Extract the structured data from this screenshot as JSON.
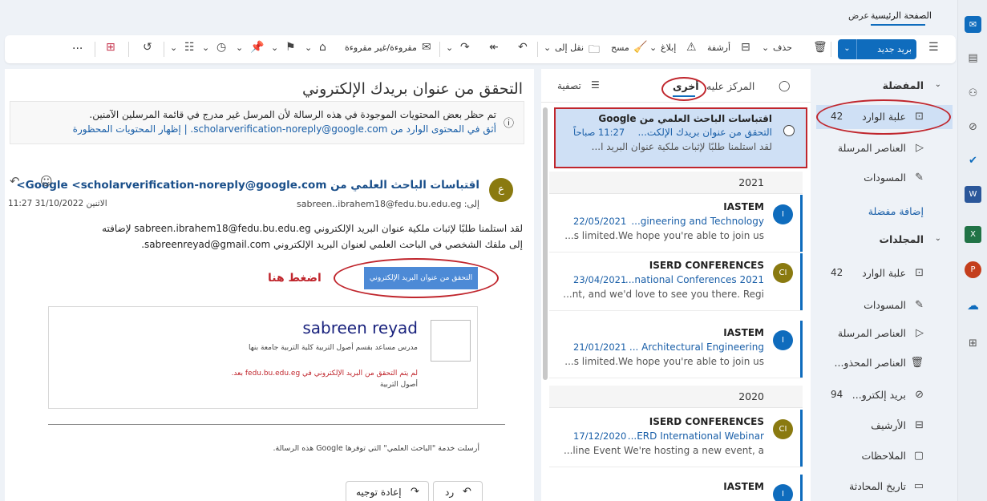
{
  "tabs": {
    "home": "الصفحة الرئيسية",
    "view": "عرض"
  },
  "ribbon": {
    "new_mail": "بريد جديد",
    "delete": "حذف",
    "archive": "أرشفة",
    "report": "إبلاغ",
    "sweep": "مسح",
    "move_to": "نقل إلى",
    "read_unread": "مقروءة/غير مقروءة",
    "more": "..."
  },
  "folders": {
    "favorites_header": "المفضلة",
    "favorites": [
      {
        "label": "علبة الوارد",
        "count": "42"
      },
      {
        "label": "العناصر المرسلة",
        "count": ""
      },
      {
        "label": "المسودات",
        "count": ""
      }
    ],
    "add_favorite": "إضافة مفضلة",
    "folders_header": "المجلدات",
    "items": [
      {
        "label": "علبة الوارد",
        "count": "42"
      },
      {
        "label": "المسودات",
        "count": ""
      },
      {
        "label": "العناصر المرسلة",
        "count": ""
      },
      {
        "label": "العناصر المحذو...",
        "count": ""
      },
      {
        "label": "بريد إلكترو...",
        "count": "94"
      },
      {
        "label": "الأرشيف",
        "count": ""
      },
      {
        "label": "الملاحظات",
        "count": ""
      },
      {
        "label": "تاريخ المحادثة",
        "count": ""
      }
    ]
  },
  "list": {
    "focused_tab": "المركز عليه",
    "other_tab": "أخرى",
    "filter": "تصفية",
    "selected": {
      "sender": "اقتباسات الباحث العلمي من Google",
      "subject": "التحقق من عنوان بريدك الإلكت...",
      "time": "11:27 صباحاً",
      "preview": "لقد استلمنا طلبًا لإثبات ملكية عنوان البريد ا..."
    },
    "year_2021": "2021",
    "year_2020": "2020",
    "messages": [
      {
        "sender": "IASTEM",
        "initial": "I",
        "date": "22/05/2021",
        "subject": "...gineering and Technology",
        "preview": "...s limited.We hope you're able to join us",
        "color": "#0f6cbd"
      },
      {
        "sender": "ISERD CONFERENCES",
        "initial": "CI",
        "date": "23/04/2021",
        "subject": "...national Conferences 2021",
        "preview": "...nt, and we'd love to see you there. Regi",
        "color": "#8a7a10"
      },
      {
        "sender": "IASTEM",
        "initial": "I",
        "date": "21/01/2021",
        "subject": "... Architectural Engineering",
        "preview": "...s limited.We hope you're able to join us",
        "color": "#0f6cbd"
      },
      {
        "sender": "ISERD CONFERENCES",
        "initial": "CI",
        "date": "17/12/2020",
        "subject": "...ERD International Webinar",
        "preview": "...line Event We're hosting a new event, a",
        "color": "#8a7a10"
      },
      {
        "sender": "IASTEM",
        "initial": "I",
        "date": "",
        "subject": "",
        "preview": "",
        "color": "#0f6cbd"
      }
    ]
  },
  "reading": {
    "title": "التحقق من عنوان بريدك الإلكتروني",
    "warning_line1": "تم حظر بعض المحتويات الموجودة في هذه الرسالة لأن المرسل غير مدرج في قائمة المرسلين الآمنين.",
    "warning_line2": "أثق في المحتوى الوارد من scholarverification-noreply@google.com. | إظهار المحتويات المحظورة",
    "sender": "اقتباسات الباحث العلمي من Google <scholarverification-noreply@google.com>",
    "avatar_initial": "ع",
    "to_label": "إلى:",
    "to": "sabreen..ibrahem18@fedu.bu.edu.eg",
    "date": "الاثنين 31/10/2022 11:27",
    "body_line1": "لقد استلمنا طلبًا لإثبات ملكية عنوان البريد الإلكتروني sabreen.ibrahem18@fedu.bu.edu.eg لإضافته",
    "body_line2": "إلى ملفك الشخصي في الباحث العلمي لعنوان البريد الإلكتروني sabreenreyad@gmail.com.",
    "verify_button": "التحقق من عنوان البريد الإلكتروني",
    "click_here": "اضغط هنا",
    "card_name": "sabreen reyad",
    "card_title": "مدرس مساعد بقسم أصول التربية كلية التربية جامعة بنها",
    "card_warn1": "لم يتم التحقق من البريد الإلكتروني في fedu.bu.edu.eg بعد.",
    "card_warn2": "أصول التربية",
    "footer": "أرسلت خدمة \"الباحث العلمي\" التي توفرها Google هذه الرسالة.",
    "reply": "رد",
    "forward": "إعادة توجيه"
  },
  "colors": {
    "accent": "#0f6cbd",
    "selected": "#cfe0f5",
    "annotation": "#c0262d"
  }
}
